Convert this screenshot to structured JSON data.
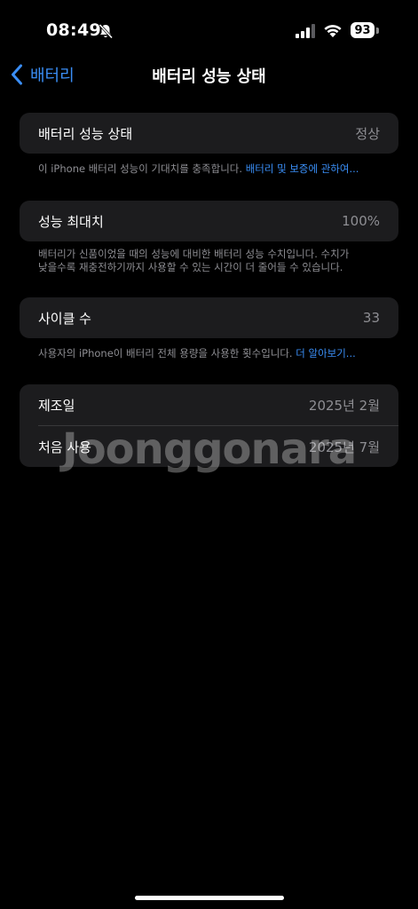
{
  "status_bar": {
    "time": "08:49",
    "battery_level": "93",
    "icons": [
      "bell-slash-icon",
      "cellular-signal-icon",
      "wifi-icon",
      "battery-icon"
    ]
  },
  "nav": {
    "back_label": "배터리",
    "title": "배터리 성능 상태"
  },
  "health": {
    "label": "배터리 성능 상태",
    "value": "정상",
    "footnote": "이 iPhone 배터리 성능이 기대치를 충족합니다.",
    "link": "배터리 및 보증에 관하여..."
  },
  "max_capacity": {
    "label": "성능 최대치",
    "value": "100%",
    "footnote_line1": "배터리가 신품이었을 때의 성능에 대비한 배터리 성능 수치입니다. 수치가",
    "footnote_line2": "낮을수록 재충전하기까지 사용할 수 있는 시간이 더 줄어들 수 있습니다."
  },
  "cycle_count": {
    "label": "사이클 수",
    "value": "33",
    "footnote": "사용자의 iPhone이 배터리 전체 용량을 사용한 횟수입니다.",
    "link": "더 알아보기..."
  },
  "dates": {
    "manufacture_label": "제조일",
    "manufacture_value": "2025년 2월",
    "first_use_label": "처음 사용",
    "first_use_value": "2025년 7월"
  },
  "watermark": "Joonggonara",
  "colors": {
    "accent": "#3a8ef6",
    "card_bg": "#1c1c1e",
    "secondary_text": "#8e8e93"
  }
}
